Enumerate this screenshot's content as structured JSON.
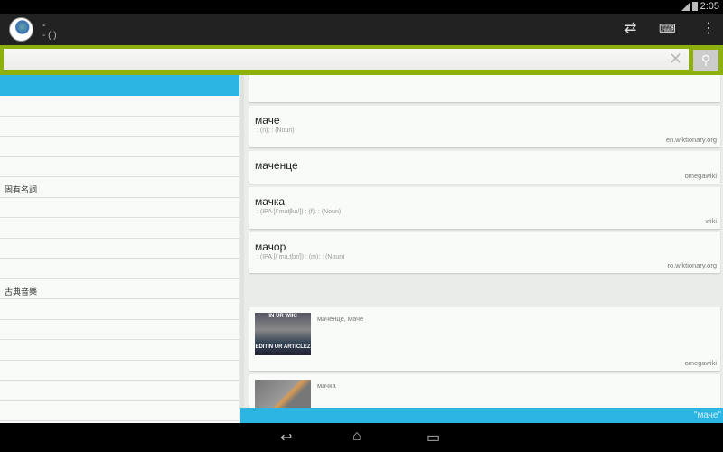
{
  "status": {
    "time": "2:05",
    "network": "3G"
  },
  "header": {
    "title": "-",
    "subtitle": "-  ( )",
    "icons": [
      "sync-icon",
      "keyboard-icon",
      "overflow-menu-icon"
    ]
  },
  "search": {
    "value": "",
    "placeholder": ""
  },
  "sidebar": {
    "items": [
      "",
      "",
      "",
      "",
      "固有名詞",
      "",
      "",
      "",
      "",
      "古典音樂",
      "",
      "",
      "",
      "",
      "",
      ""
    ]
  },
  "results": [
    {
      "word": "маче",
      "detail": ": (n);   : (Noun)",
      "source": "en.wiktionary.org"
    },
    {
      "word": "маченце",
      "detail": "",
      "source": "omegawiki"
    },
    {
      "word": "мачка",
      "detail": ": (IPA [/ˈmatʃka/])   : (f);   : (Noun)",
      "source": "wiki"
    },
    {
      "word": "мачор",
      "detail": ": (IPA [/ˈma.tʃɔr/])   : (m);   : (Noun)",
      "source": "ro.wiktionary.org"
    }
  ],
  "images": [
    {
      "caption": "маченце, маче",
      "source": "omegawiki",
      "meme_top": "IN UR WIKI",
      "meme_bottom": "EDITIN UR ARTICLEZ"
    },
    {
      "caption": "мачка",
      "source": ""
    }
  ],
  "footer": {
    "query": "\"маче\""
  },
  "colors": {
    "accent": "#8db00e",
    "blue": "#2cb5e2"
  }
}
